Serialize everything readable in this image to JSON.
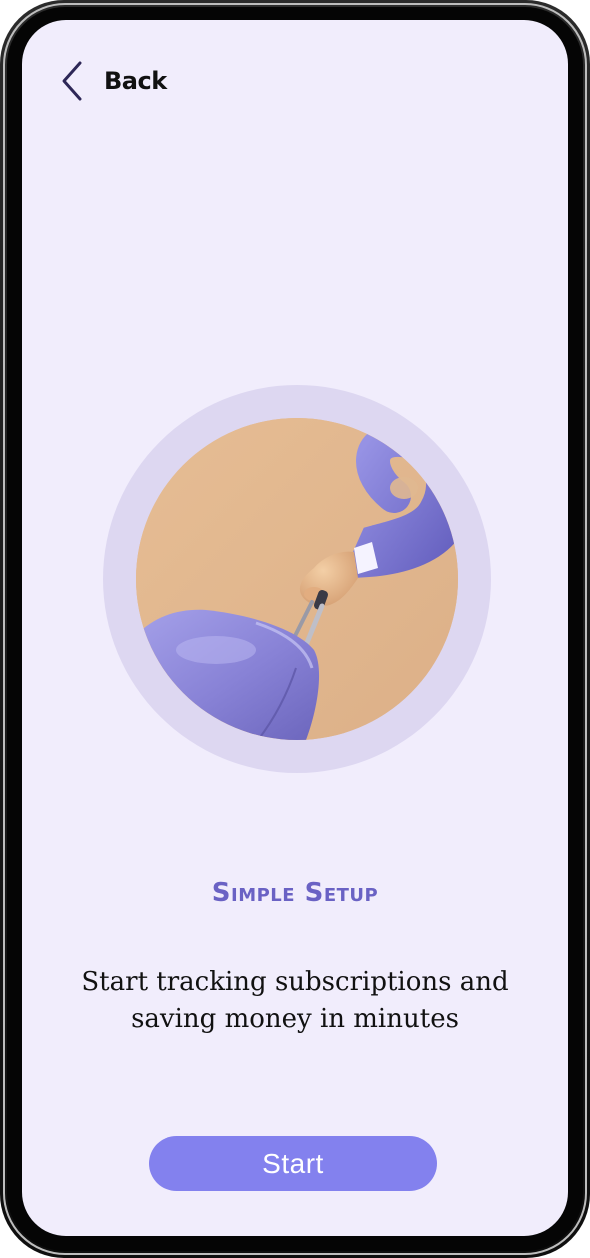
{
  "header": {
    "back_label": "Back",
    "back_icon": "chevron-left-icon"
  },
  "illustration": {
    "subject": "hand-holding-suitcase",
    "colors": {
      "ring": "#ddd7f1",
      "background": "#e3b88f",
      "suitcase": "#8b86d6",
      "sleeve": "#7c78d2"
    }
  },
  "onboarding": {
    "title": "Simple Setup",
    "subtitle": "Start tracking subscriptions and saving money in minutes"
  },
  "actions": {
    "start_label": "Start"
  },
  "theme": {
    "screen_background": "#f1edfc",
    "accent": "#8381ee",
    "title_color": "#6a62c4",
    "text_color": "#111111"
  }
}
